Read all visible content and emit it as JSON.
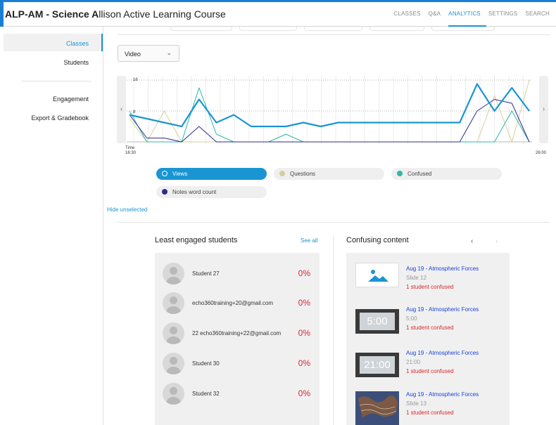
{
  "header": {
    "title_bold": "ALP-AM - Science A",
    "title_rest": "llison Active Learning Course",
    "nav": [
      {
        "label": "CLASSES",
        "active": false
      },
      {
        "label": "Q&A",
        "active": false
      },
      {
        "label": "ANALYTICS",
        "active": true
      },
      {
        "label": "SETTINGS",
        "active": false
      },
      {
        "label": "SEARCH",
        "active": false
      }
    ]
  },
  "sidebar": {
    "items": [
      {
        "label": "Classes",
        "active": true
      },
      {
        "label": "Students",
        "active": false
      },
      {
        "label": "Engagement",
        "active": false
      },
      {
        "label": "Export & Gradebook",
        "active": false
      }
    ]
  },
  "filter": {
    "selected": "Video"
  },
  "chart_data": {
    "type": "line",
    "x": [
      1,
      2,
      3,
      4,
      5,
      6,
      7,
      8,
      9,
      10,
      11,
      12,
      13,
      14,
      15,
      16,
      17,
      18,
      19,
      20,
      21,
      22,
      23,
      24,
      25,
      26,
      27,
      28
    ],
    "series": [
      {
        "name": "Views",
        "color": "#1a95d3",
        "values": [
          7,
          6,
          5,
          4,
          11,
          5,
          7,
          4,
          4,
          4,
          5,
          4,
          5,
          5,
          5,
          5,
          5,
          5,
          5,
          5,
          15,
          8,
          14,
          8
        ]
      },
      {
        "name": "Questions",
        "color": "#d6cf9a",
        "values": [
          6,
          0,
          8,
          0,
          0,
          0,
          0,
          0,
          0,
          0,
          0,
          0,
          0,
          0,
          0,
          0,
          0,
          0,
          0,
          0,
          0,
          12,
          0,
          16
        ]
      },
      {
        "name": "Confused",
        "color": "#2fb7a8",
        "values": [
          8,
          0,
          0,
          0,
          14,
          2,
          0,
          0,
          0,
          2,
          0,
          0,
          0,
          0,
          0,
          0,
          0,
          0,
          0,
          0,
          0,
          0,
          8,
          0
        ]
      },
      {
        "name": "Notes word count",
        "color": "#2d2d8c",
        "values": [
          7,
          1,
          1,
          0,
          4,
          0,
          0,
          0,
          0,
          0,
          0,
          0,
          0,
          0,
          0,
          0,
          0,
          0,
          0,
          0,
          8,
          11,
          10,
          0
        ]
      }
    ],
    "y_ticks": [
      "16",
      "8"
    ],
    "ylim": [
      0,
      16
    ],
    "x_start_label": "Time\n16:30",
    "x_start_time": "16:30",
    "x_label_prefix": "Time",
    "x_end_label": "26:00",
    "grid": true
  },
  "legend": {
    "views": "Views",
    "questions": "Questions",
    "confused": "Confused",
    "notes": "Notes word count"
  },
  "hide_unselected": "Hide unselected",
  "least_engaged": {
    "title": "Least engaged students",
    "see_all": "See all",
    "students": [
      {
        "name": "Student 27",
        "pct": "0%"
      },
      {
        "name": "echo360training+20@gmail.com",
        "pct": "0%"
      },
      {
        "name": "22 echo360training+22@gmail.com",
        "pct": "0%"
      },
      {
        "name": "Student 30",
        "pct": "0%"
      },
      {
        "name": "Student 32",
        "pct": "0%"
      }
    ]
  },
  "confusing": {
    "title": "Confusing content",
    "items": [
      {
        "title": "Aug 19 - Atmospheric Forces",
        "sub": "Slide 12",
        "status": "1 student confused",
        "thumb": "image-placeholder-icon",
        "time": ""
      },
      {
        "title": "Aug 19 - Atmospheric Forces",
        "sub": "5:00",
        "status": "1 student confused",
        "thumb": "video",
        "time": "5:00"
      },
      {
        "title": "Aug 19 - Atmospheric Forces",
        "sub": "21:00",
        "status": "1 student confused",
        "thumb": "video",
        "time": "21:00"
      },
      {
        "title": "Aug 19 - Atmospheric Forces",
        "sub": "Slide 13",
        "status": "1 student confused",
        "thumb": "map",
        "time": ""
      }
    ]
  }
}
